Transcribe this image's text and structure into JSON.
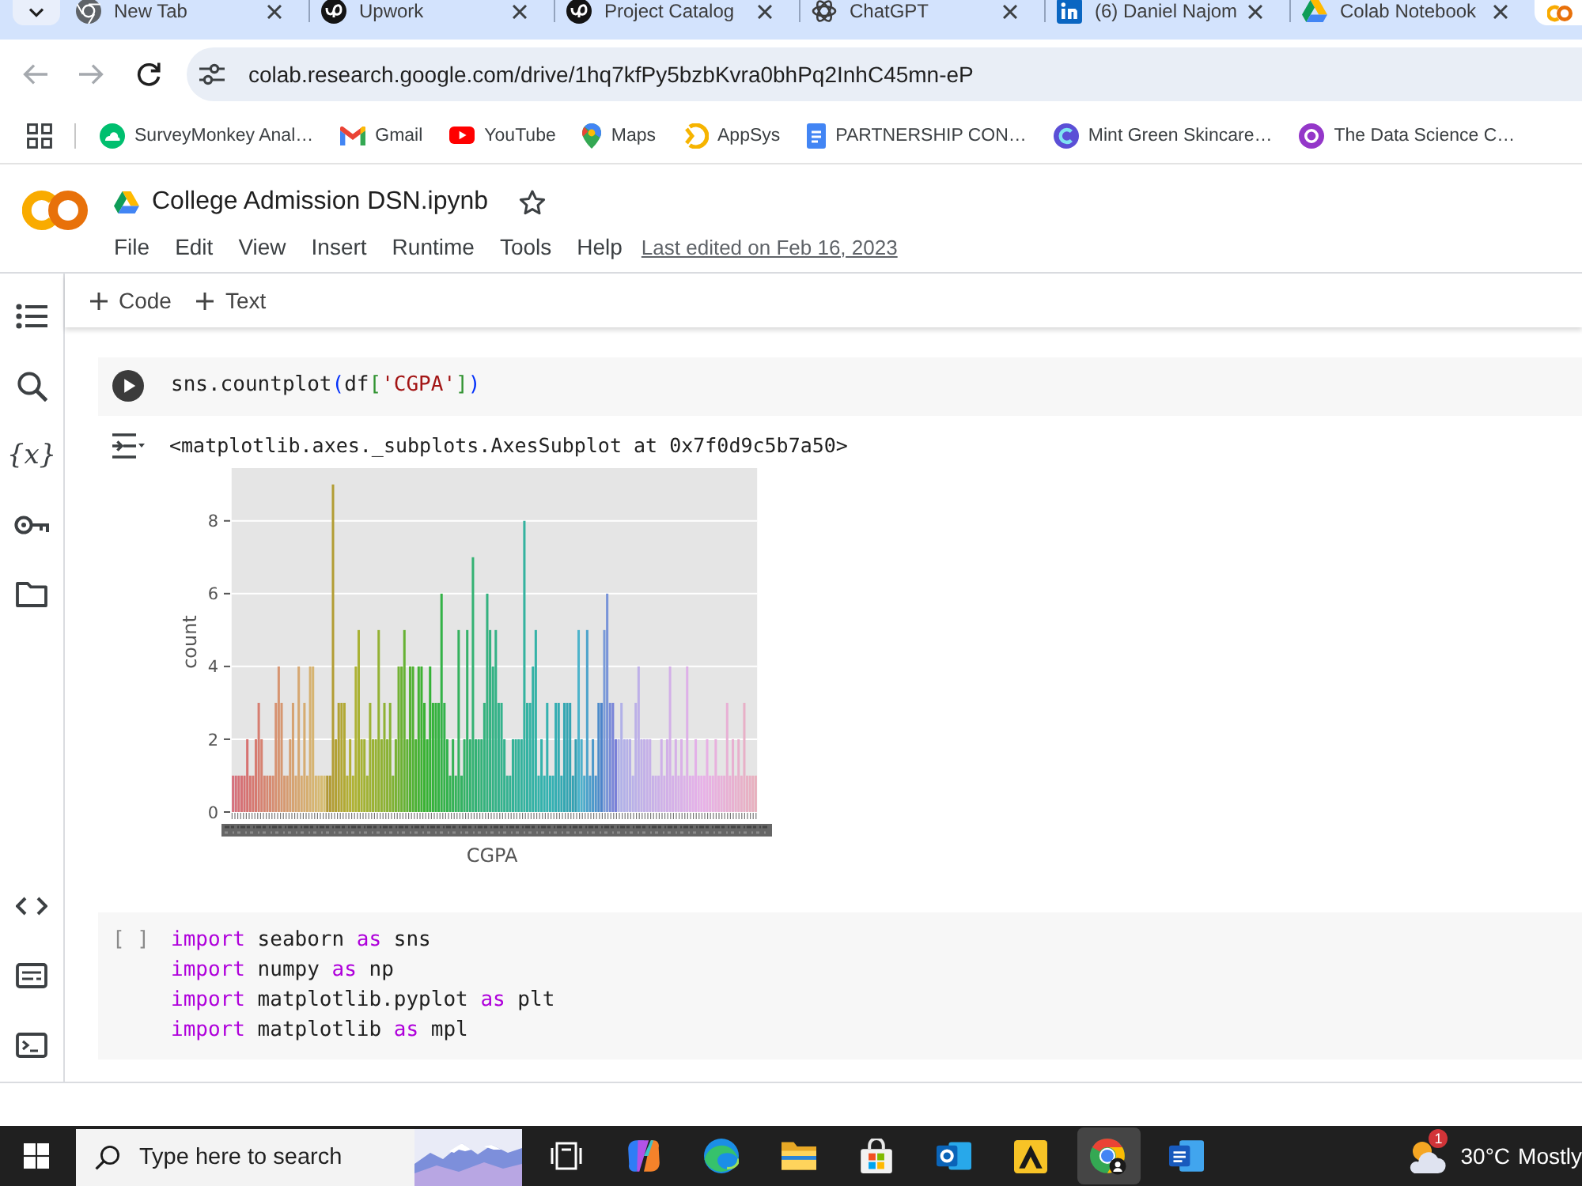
{
  "browser": {
    "tabs": [
      {
        "title": "New Tab",
        "selected": false
      },
      {
        "title": "Upwork",
        "selected": false
      },
      {
        "title": "Project Catalog",
        "selected": false
      },
      {
        "title": "ChatGPT",
        "selected": false
      },
      {
        "title": "(6) Daniel Najom",
        "selected": false
      },
      {
        "title": "Colab Notebook",
        "selected": false
      },
      {
        "selected": true
      }
    ],
    "navigation": {
      "back_disabled": true,
      "forward_disabled": true
    },
    "address": {
      "url": "colab.research.google.com/drive/1hq7kfPy5bzbKvra0bhPq2InhC45mn-eP"
    },
    "bookmarks": [
      {
        "label": "SurveyMonkey Anal…"
      },
      {
        "label": "Gmail"
      },
      {
        "label": "YouTube"
      },
      {
        "label": "Maps"
      },
      {
        "label": "AppSys"
      },
      {
        "label": "PARTNERSHIP CON…"
      },
      {
        "label": "Mint Green Skincare…"
      },
      {
        "label": "The Data Science C…"
      }
    ]
  },
  "notebook": {
    "title": "College Admission DSN.ipynb",
    "starred": false,
    "menu": [
      "File",
      "Edit",
      "View",
      "Insert",
      "Runtime",
      "Tools",
      "Help"
    ],
    "last_edited": "Last edited on Feb 16, 2023",
    "toolbar": [
      "Code",
      "Text"
    ],
    "sidebar": {
      "variables_label": "{x}"
    },
    "cells": [
      {
        "focused": true,
        "lines": [
          [
            {
              "text": "sns.countplot",
              "kind": "plain"
            },
            {
              "text": "(",
              "kind": "bracket1"
            },
            {
              "text": "df",
              "kind": "plain"
            },
            {
              "text": "[",
              "kind": "bracket2"
            },
            {
              "text": "'CGPA'",
              "kind": "string"
            },
            {
              "text": "]",
              "kind": "bracket2"
            },
            {
              "text": ")",
              "kind": "bracket1"
            }
          ]
        ],
        "output": {
          "text": "<matplotlib.axes._subplots.AxesSubplot at 0x7f0d9c5b7a50>",
          "chart_data": {
            "type": "bar",
            "xlabel": "CGPA",
            "ylabel": "count",
            "ylim": [
              0,
              9.45
            ],
            "yticks": [
              0,
              2,
              4,
              6,
              8
            ],
            "grid": true,
            "values": [
              1,
              1,
              1,
              1,
              1,
              2,
              1,
              1,
              2,
              3,
              2,
              1,
              1,
              1,
              1,
              3,
              4,
              3,
              1,
              1,
              2,
              3,
              1,
              4,
              1,
              3,
              1,
              4,
              4,
              1,
              1,
              1,
              1,
              1,
              1,
              9,
              2,
              3,
              3,
              3,
              1,
              2,
              1,
              4,
              5,
              2,
              2,
              1,
              3,
              2,
              2,
              5,
              2,
              3,
              2,
              3,
              1,
              2,
              4,
              4,
              5,
              2,
              4,
              4,
              2,
              4,
              4,
              3,
              2,
              4,
              3,
              3,
              3,
              6,
              3,
              2,
              1,
              2,
              1,
              5,
              1,
              2,
              5,
              2,
              7,
              2,
              2,
              2,
              3,
              6,
              5,
              4,
              5,
              3,
              3,
              2,
              1,
              1,
              2,
              2,
              2,
              2,
              8,
              3,
              3,
              4,
              5,
              1,
              2,
              1,
              3,
              1,
              1,
              3,
              3,
              1,
              3,
              3,
              3,
              1,
              2,
              5,
              2,
              1,
              5,
              1,
              2,
              1,
              3,
              3,
              5,
              6,
              3,
              3,
              2,
              2,
              3,
              2,
              2,
              2,
              1,
              3,
              4,
              2,
              2,
              2,
              2,
              1,
              1,
              1,
              2,
              1,
              2,
              4,
              1,
              2,
              1,
              2,
              1,
              4,
              1,
              1,
              2,
              1,
              1,
              1,
              2,
              1,
              1,
              2,
              1,
              1,
              1,
              3,
              1,
              2,
              1,
              2,
              1,
              3,
              1,
              1,
              1,
              1
            ]
          }
        }
      },
      {
        "focused": false,
        "prompt": "[ ]",
        "lines": [
          [
            {
              "text": "import",
              "kind": "keyword"
            },
            {
              "text": " seaborn ",
              "kind": "plain"
            },
            {
              "text": "as",
              "kind": "keyword"
            },
            {
              "text": " sns",
              "kind": "plain"
            }
          ],
          [
            {
              "text": "import",
              "kind": "keyword"
            },
            {
              "text": " numpy ",
              "kind": "plain"
            },
            {
              "text": "as",
              "kind": "keyword"
            },
            {
              "text": " np",
              "kind": "plain"
            }
          ],
          [
            {
              "text": "import",
              "kind": "keyword"
            },
            {
              "text": " matplotlib.pyplot ",
              "kind": "plain"
            },
            {
              "text": "as",
              "kind": "keyword"
            },
            {
              "text": " plt",
              "kind": "plain"
            }
          ],
          [
            {
              "text": "import",
              "kind": "keyword"
            },
            {
              "text": " matplotlib ",
              "kind": "plain"
            },
            {
              "text": "as",
              "kind": "keyword"
            },
            {
              "text": " mpl",
              "kind": "plain"
            }
          ]
        ]
      }
    ]
  },
  "taskbar": {
    "search": {
      "placeholder": "Type here to search"
    },
    "apps": [
      {
        "active": false
      },
      {
        "active": false
      },
      {
        "active": false
      },
      {
        "active": false
      },
      {
        "active": false
      },
      {
        "active": false
      },
      {
        "active": true
      },
      {
        "active": false
      }
    ],
    "weather": {
      "badge": "1",
      "temperature": "30°C",
      "condition": "Mostly"
    }
  }
}
